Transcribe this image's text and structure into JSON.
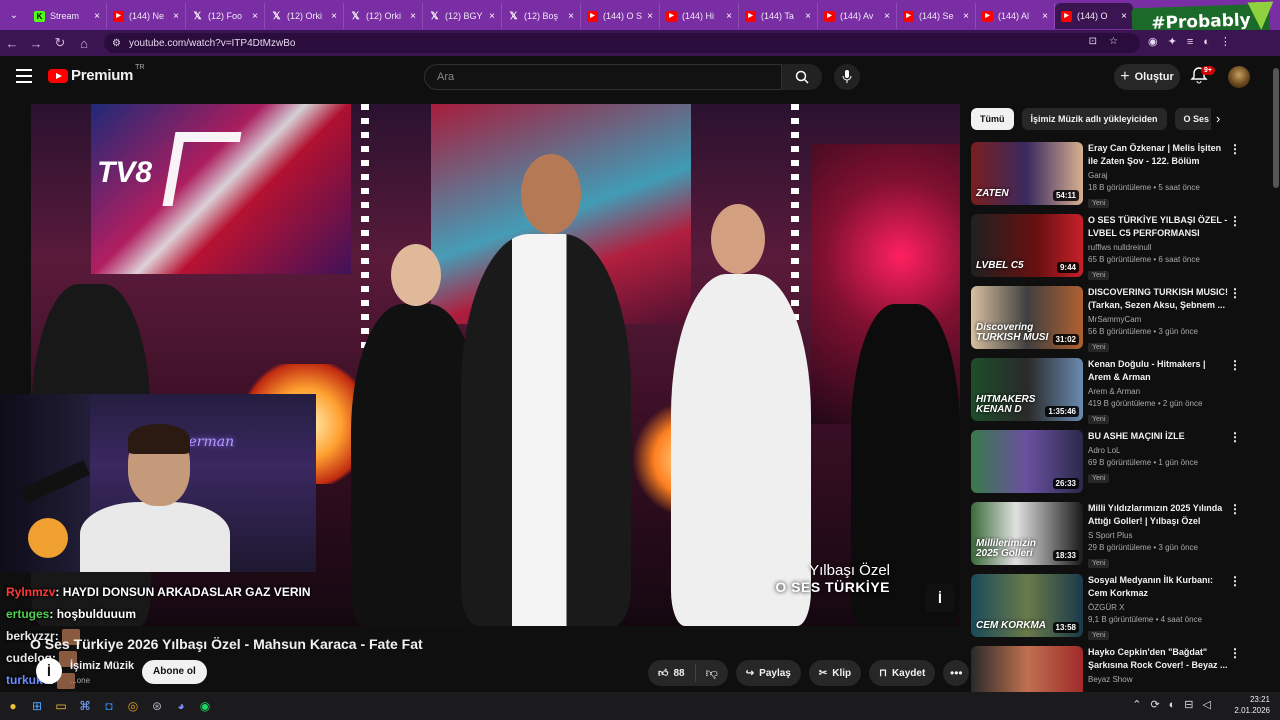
{
  "browser": {
    "tabs": [
      {
        "icon": "kick-icon",
        "label": "Stream"
      },
      {
        "icon": "youtube-icon",
        "label": "(144) Ne"
      },
      {
        "icon": "x-icon",
        "label": "(12) Foo"
      },
      {
        "icon": "x-icon",
        "label": "(12) Orki"
      },
      {
        "icon": "x-icon",
        "label": "(12) Orki"
      },
      {
        "icon": "x-icon",
        "label": "(12) BGY"
      },
      {
        "icon": "x-icon",
        "label": "(12) Boş"
      },
      {
        "icon": "youtube-icon",
        "label": "(144) O S"
      },
      {
        "icon": "youtube-icon",
        "label": "(144) Hi"
      },
      {
        "icon": "youtube-icon",
        "label": "(144) Ta"
      },
      {
        "icon": "youtube-icon",
        "label": "(144) Av"
      },
      {
        "icon": "youtube-icon",
        "label": "(144) Se"
      },
      {
        "icon": "youtube-icon",
        "label": "(144) Al"
      },
      {
        "icon": "youtube-icon",
        "label": "(144) O"
      }
    ],
    "url": "youtube.com/watch?v=ITP4DtMzwBo",
    "overlay_badge": "#Probably"
  },
  "youtube": {
    "logo": "Premium",
    "logo_sup": "TR",
    "search_placeholder": "Ara",
    "create_label": "Oluştur",
    "notifications_badge": "9+"
  },
  "video": {
    "title": "O Ses Türkiye 2026 Yılbaşı Özel - Mahsun Karaca - Fate Fat",
    "channel": "İşimiz Müzik",
    "subscribers": "...one",
    "subscribe_label": "Abone ol",
    "like_count": "88",
    "share_label": "Paylaş",
    "clip_label": "Klip",
    "save_label": "Kaydet",
    "overlay_line1": "Yılbaşı Özel",
    "overlay_line2": "O SES TÜRKİYE",
    "channel_mark": "TV8"
  },
  "chat": [
    {
      "user": "Rylnmzv",
      "msg": ": HAYDI DONSUN ARKADASLAR GAZ VERIN",
      "color": "#ff3b3b"
    },
    {
      "user": "ertuges",
      "msg": ": hoşbulduuum",
      "color": "#4dd04d"
    },
    {
      "user": "berkyzzr",
      "msg": ":",
      "color": "#e8e8e8"
    },
    {
      "user": "cudeloq",
      "msg": ":",
      "color": "#e8e8e8"
    },
    {
      "user": "turkuko",
      "msg": ":",
      "color": "#6a8cff"
    }
  ],
  "chips": [
    "Tümü",
    "İşimiz Müzik adlı yükleyiciden",
    "O Ses T"
  ],
  "recommendations": [
    {
      "title": "Eray Can Özkenar | Melis İşiten ile Zaten Şov - 122. Bölüm",
      "channel": "Garaj",
      "stats": "18 B görüntüleme • 5 saat önce",
      "badge": "Yeni",
      "duration": "54:11",
      "thumb_text": "ZATEN"
    },
    {
      "title": "O SES TÜRKİYE YILBAŞI ÖZEL - LVBEL C5 PERFORMANSI",
      "channel": "rufflws nulldreinull",
      "stats": "65 B görüntüleme • 6 saat önce",
      "badge": "Yeni",
      "duration": "9:44",
      "thumb_text": "LVBEL C5"
    },
    {
      "title": "DISCOVERING TURKISH MUSIC! (Tarkan, Sezen Aksu, Şebnem ...",
      "channel": "MrSammyCam",
      "stats": "56 B görüntüleme • 3 gün önce",
      "badge": "Yeni",
      "duration": "31:02",
      "thumb_text": "Discovering TURKISH MUSI"
    },
    {
      "title": "Kenan Doğulu - Hitmakers | Arem & Arman",
      "channel": "Arem & Arman",
      "stats": "419 B görüntüleme • 2 gün önce",
      "badge": "Yeni",
      "duration": "1:35:46",
      "thumb_text": "HITMAKERS KENAN D"
    },
    {
      "title": "BU ASHE MAÇINI İZLE",
      "channel": "Adro LoL",
      "stats": "69 B görüntüleme • 1 gün önce",
      "badge": "Yeni",
      "duration": "26:33",
      "thumb_text": ""
    },
    {
      "title": "Milli Yıldızlarımızın 2025 Yılında Attığı Goller! | Yılbaşı Özel",
      "channel": "S Sport Plus",
      "stats": "29 B görüntüleme • 3 gün önce",
      "badge": "Yeni",
      "duration": "18:33",
      "thumb_text": "Millilerimizin 2025 Golleri"
    },
    {
      "title": "Sosyal Medyanın İlk Kurbanı: Cem Korkmaz",
      "channel": "ÖZGÜR X",
      "stats": "9,1 B görüntüleme • 4 saat önce",
      "badge": "Yeni",
      "duration": "13:58",
      "thumb_text": "CEM KORKMA"
    },
    {
      "title": "Hayko Cepkin'den \"Bağdat\" Şarkısına Rock Cover! - Beyaz ...",
      "channel": "Beyaz Show",
      "stats": "",
      "badge": "",
      "duration": "",
      "thumb_text": ""
    }
  ],
  "taskbar": {
    "time": "23:21",
    "date": "2.01.2026"
  }
}
